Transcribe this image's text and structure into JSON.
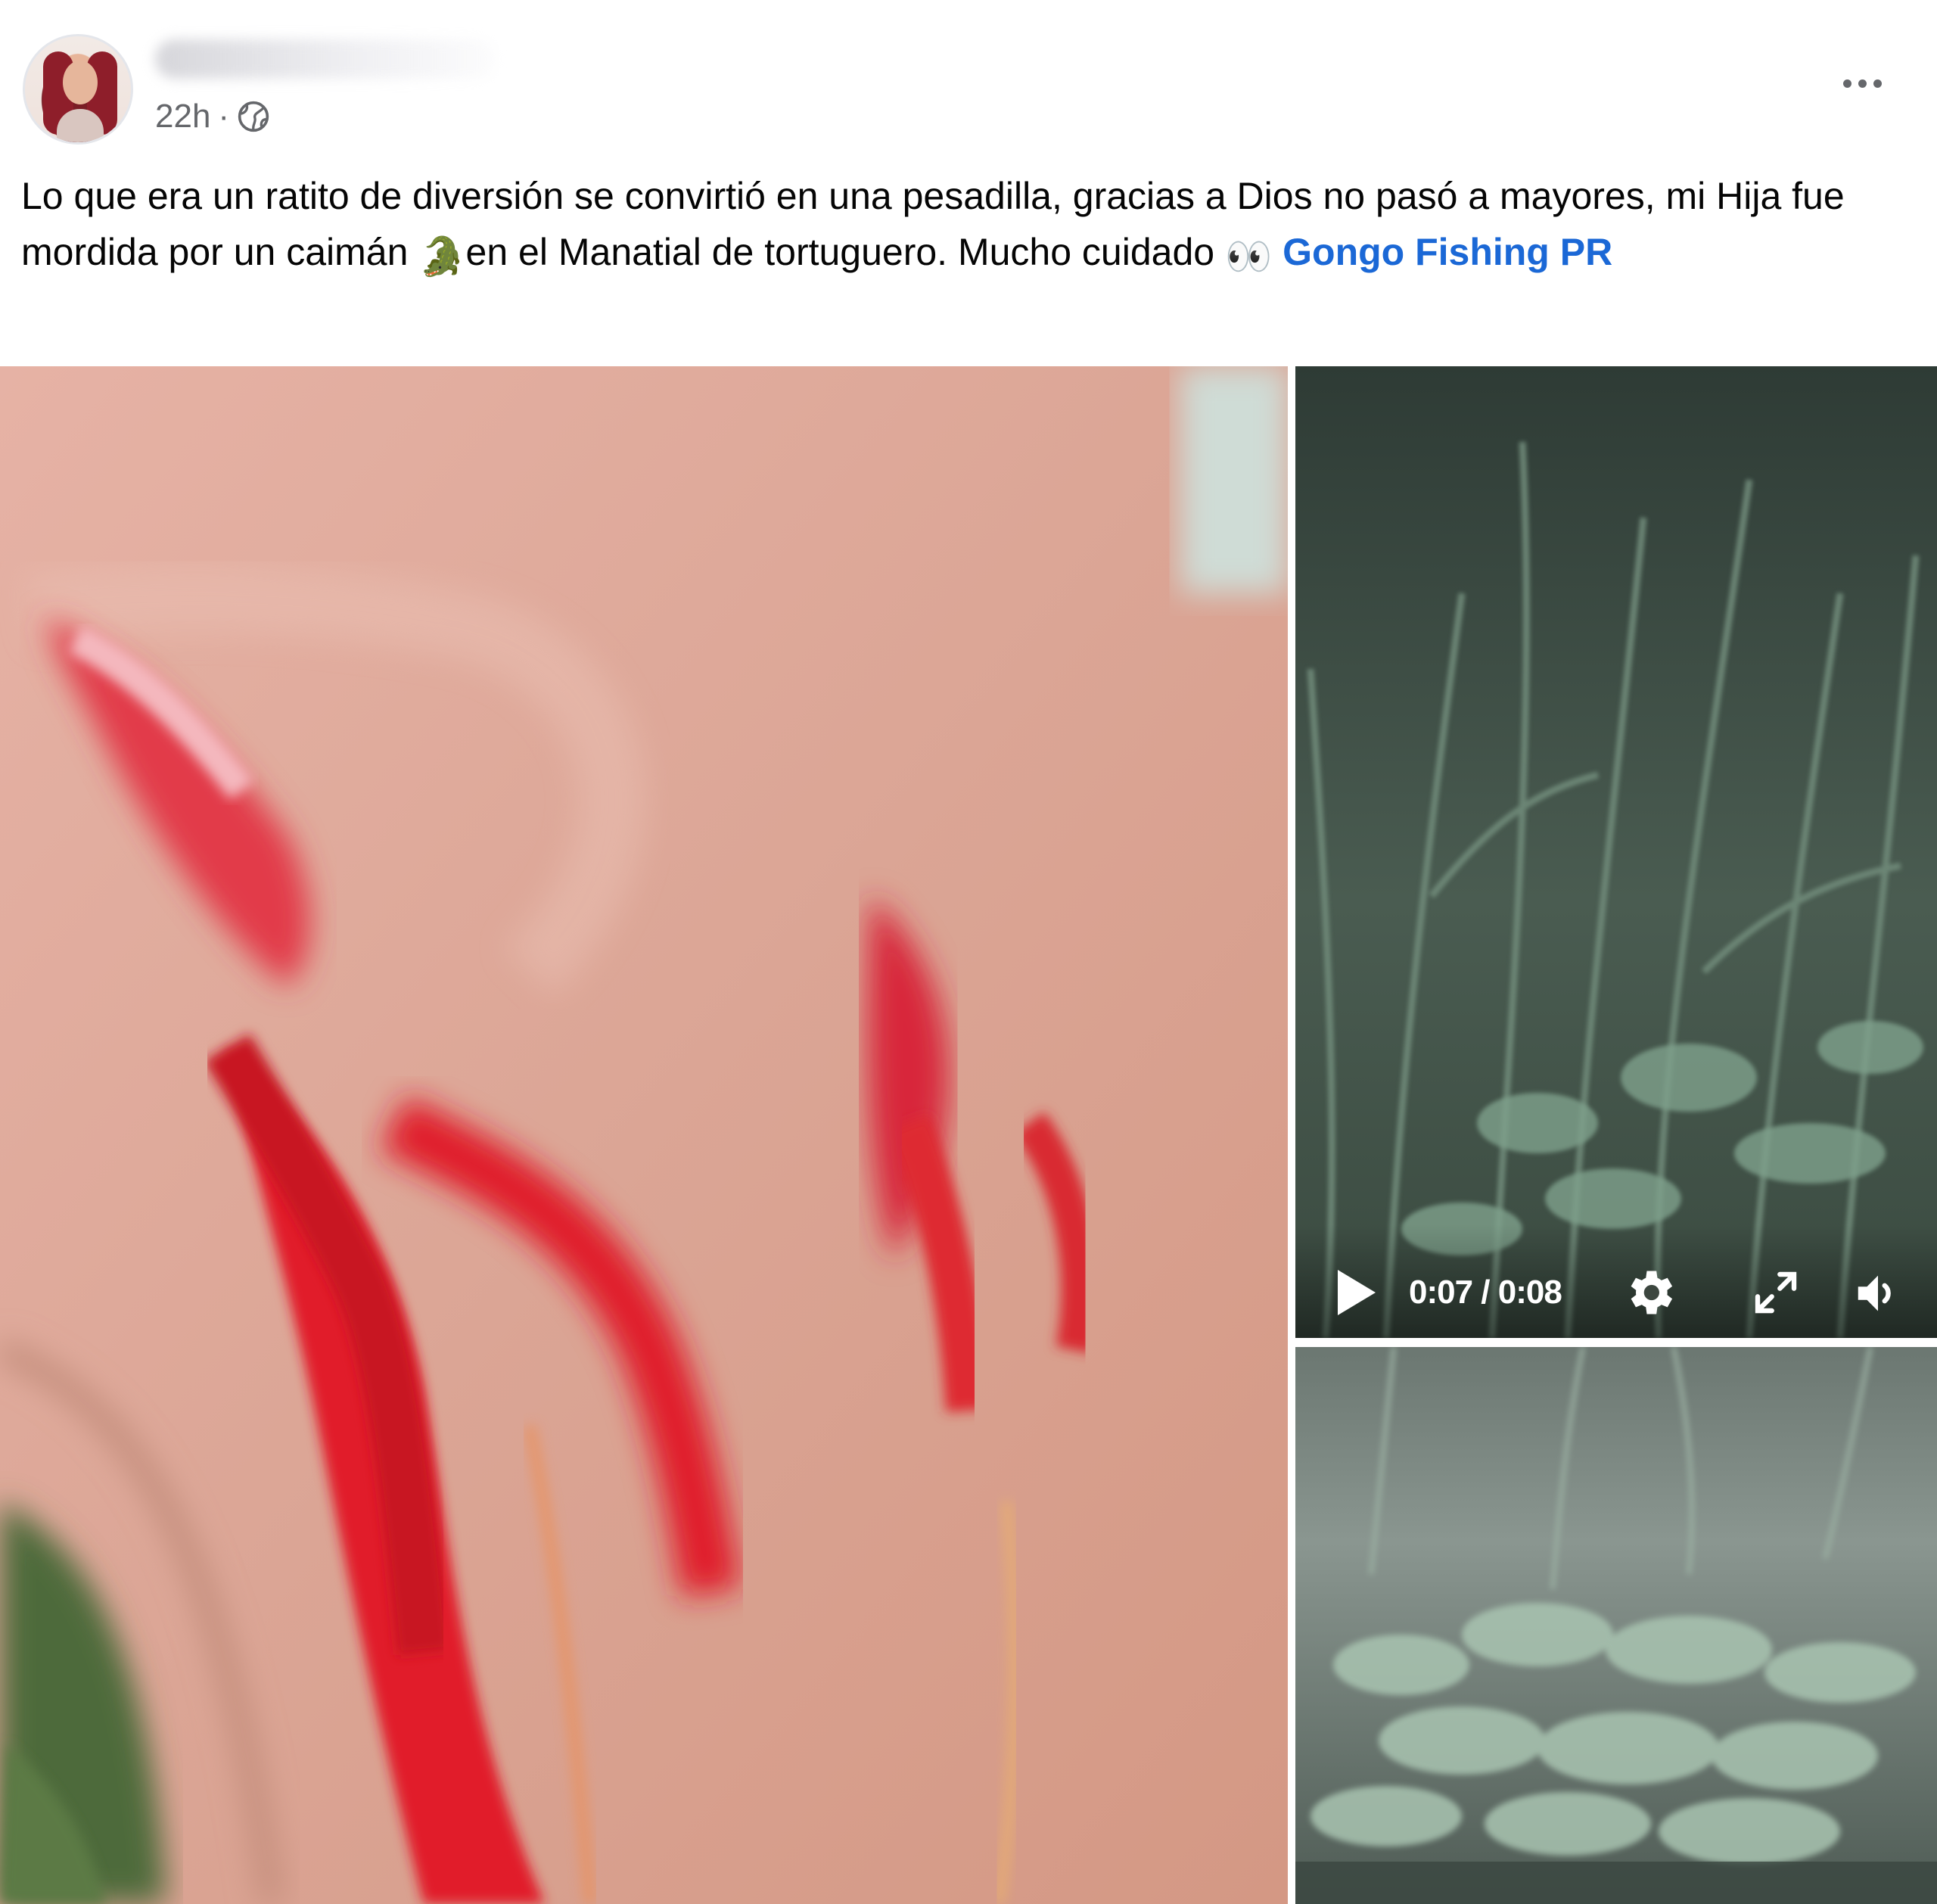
{
  "post": {
    "timestamp": "22h",
    "separator": "·",
    "privacy_icon": "globe-icon",
    "more_icon": "more-options-icon",
    "text_part1": "Lo que era un ratito de diversión se convirtió en una pesadilla, gracias a Dios no pasó a mayores, mi Hija fue mordida por un caimán ",
    "emoji_crocodile": "🐊",
    "text_part2": "en el Manatial de tortuguero. Mucho cuidado ",
    "emoji_eyes": "👀",
    "mention": "Gongo Fishing PR"
  },
  "media": {
    "video": {
      "time": "0:07 / 0:08",
      "icons": [
        "play-icon",
        "settings-gear-icon",
        "fullscreen-icon",
        "volume-icon"
      ]
    }
  },
  "colors": {
    "link": "#1b68d6",
    "meta_text": "#65676b",
    "text": "#050505"
  }
}
